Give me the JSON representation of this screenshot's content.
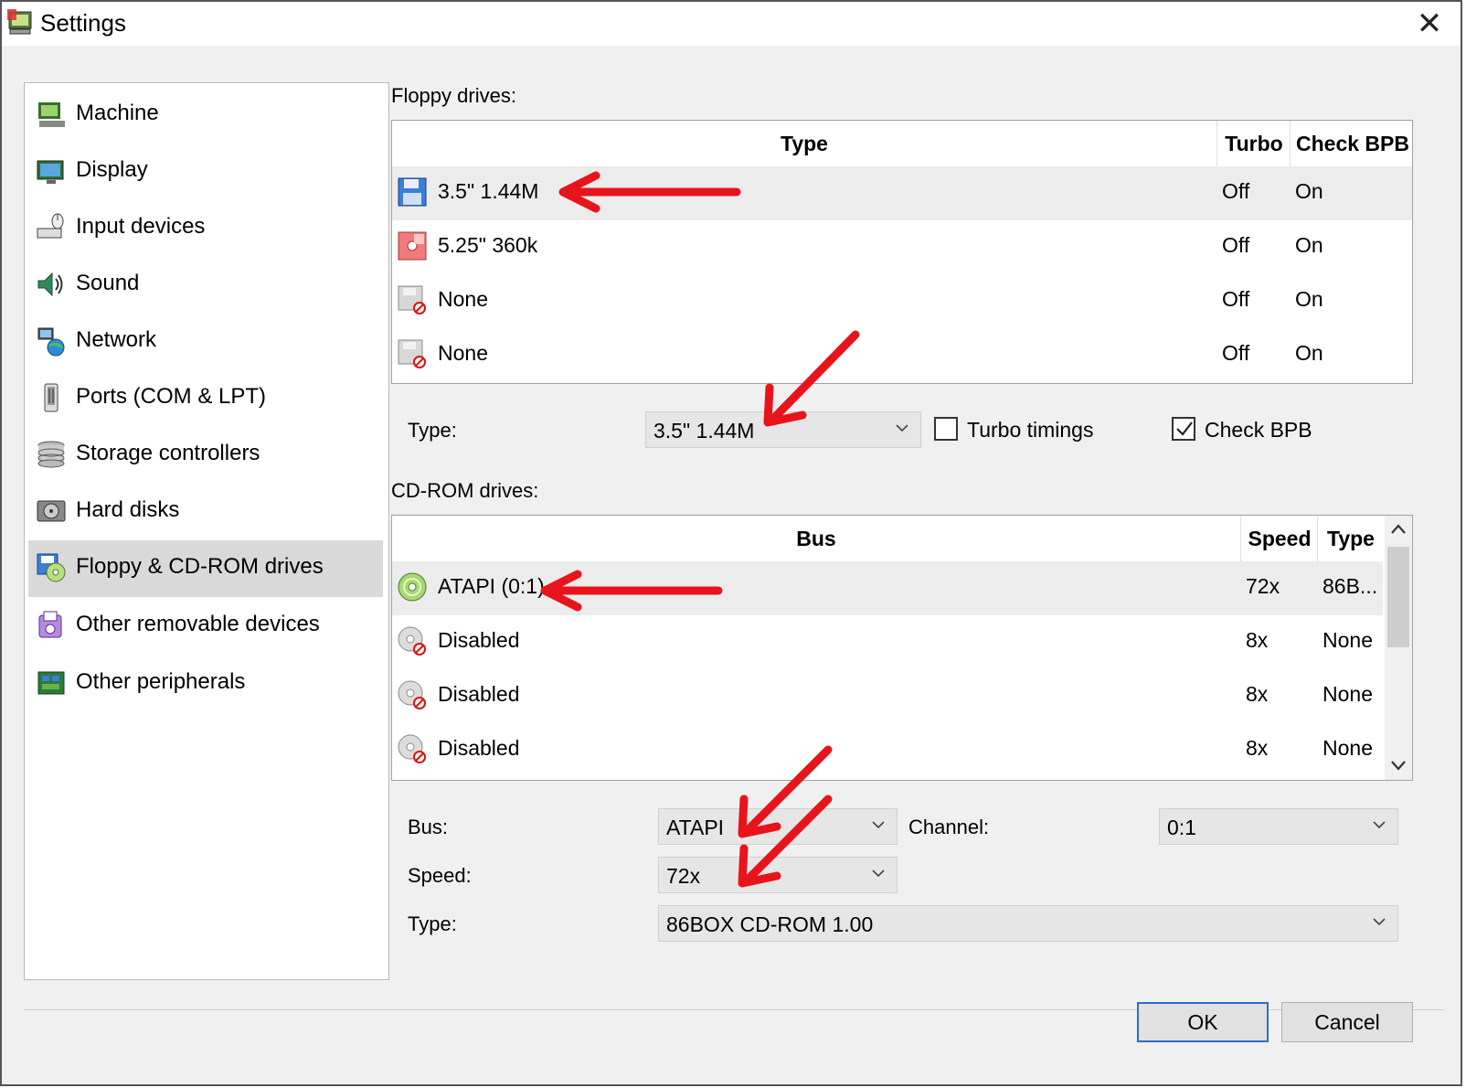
{
  "window": {
    "title": "Settings",
    "close_glyph": "✕"
  },
  "sidebar": {
    "items": [
      {
        "label": "Machine",
        "icon": "machine-icon"
      },
      {
        "label": "Display",
        "icon": "display-icon"
      },
      {
        "label": "Input devices",
        "icon": "input-devices-icon"
      },
      {
        "label": "Sound",
        "icon": "sound-icon"
      },
      {
        "label": "Network",
        "icon": "network-icon"
      },
      {
        "label": "Ports (COM & LPT)",
        "icon": "ports-icon"
      },
      {
        "label": "Storage controllers",
        "icon": "storage-controllers-icon"
      },
      {
        "label": "Hard disks",
        "icon": "hard-disk-icon"
      },
      {
        "label": "Floppy & CD-ROM drives",
        "icon": "floppy-cdrom-icon",
        "selected": true
      },
      {
        "label": "Other removable devices",
        "icon": "removable-devices-icon"
      },
      {
        "label": "Other peripherals",
        "icon": "peripherals-icon"
      }
    ]
  },
  "floppy": {
    "section_label": "Floppy drives:",
    "columns": [
      "Type",
      "Turbo",
      "Check BPB"
    ],
    "rows": [
      {
        "type": "3.5\" 1.44M",
        "turbo": "Off",
        "check_bpb": "On",
        "icon": "floppy-35-icon",
        "selected": true
      },
      {
        "type": "5.25\" 360k",
        "turbo": "Off",
        "check_bpb": "On",
        "icon": "floppy-525-icon"
      },
      {
        "type": "None",
        "turbo": "Off",
        "check_bpb": "On",
        "icon": "floppy-none-icon"
      },
      {
        "type": "None",
        "turbo": "Off",
        "check_bpb": "On",
        "icon": "floppy-none-icon"
      }
    ],
    "type_label": "Type:",
    "type_value": "3.5\" 1.44M",
    "turbo_label": "Turbo timings",
    "turbo_checked": false,
    "check_bpb_label": "Check BPB",
    "check_bpb_checked": true
  },
  "cdrom": {
    "section_label": "CD-ROM drives:",
    "columns": [
      "Bus",
      "Speed",
      "Type"
    ],
    "rows": [
      {
        "bus": "ATAPI (0:1)",
        "speed": "72x",
        "type": "86B...",
        "icon": "cdrom-icon",
        "selected": true
      },
      {
        "bus": "Disabled",
        "speed": "8x",
        "type": "None",
        "icon": "cdrom-disabled-icon"
      },
      {
        "bus": "Disabled",
        "speed": "8x",
        "type": "None",
        "icon": "cdrom-disabled-icon"
      },
      {
        "bus": "Disabled",
        "speed": "8x",
        "type": "None",
        "icon": "cdrom-disabled-icon"
      }
    ],
    "bus_label": "Bus:",
    "bus_value": "ATAPI",
    "channel_label": "Channel:",
    "channel_value": "0:1",
    "speed_label": "Speed:",
    "speed_value": "72x",
    "type_label": "Type:",
    "type_value": "86BOX CD-ROM 1.00"
  },
  "buttons": {
    "ok": "OK",
    "cancel": "Cancel"
  },
  "colors": {
    "selection": "#d9d9d9",
    "annotation_arrow": "#e8141b",
    "default_button_border": "#2a6fc9"
  }
}
